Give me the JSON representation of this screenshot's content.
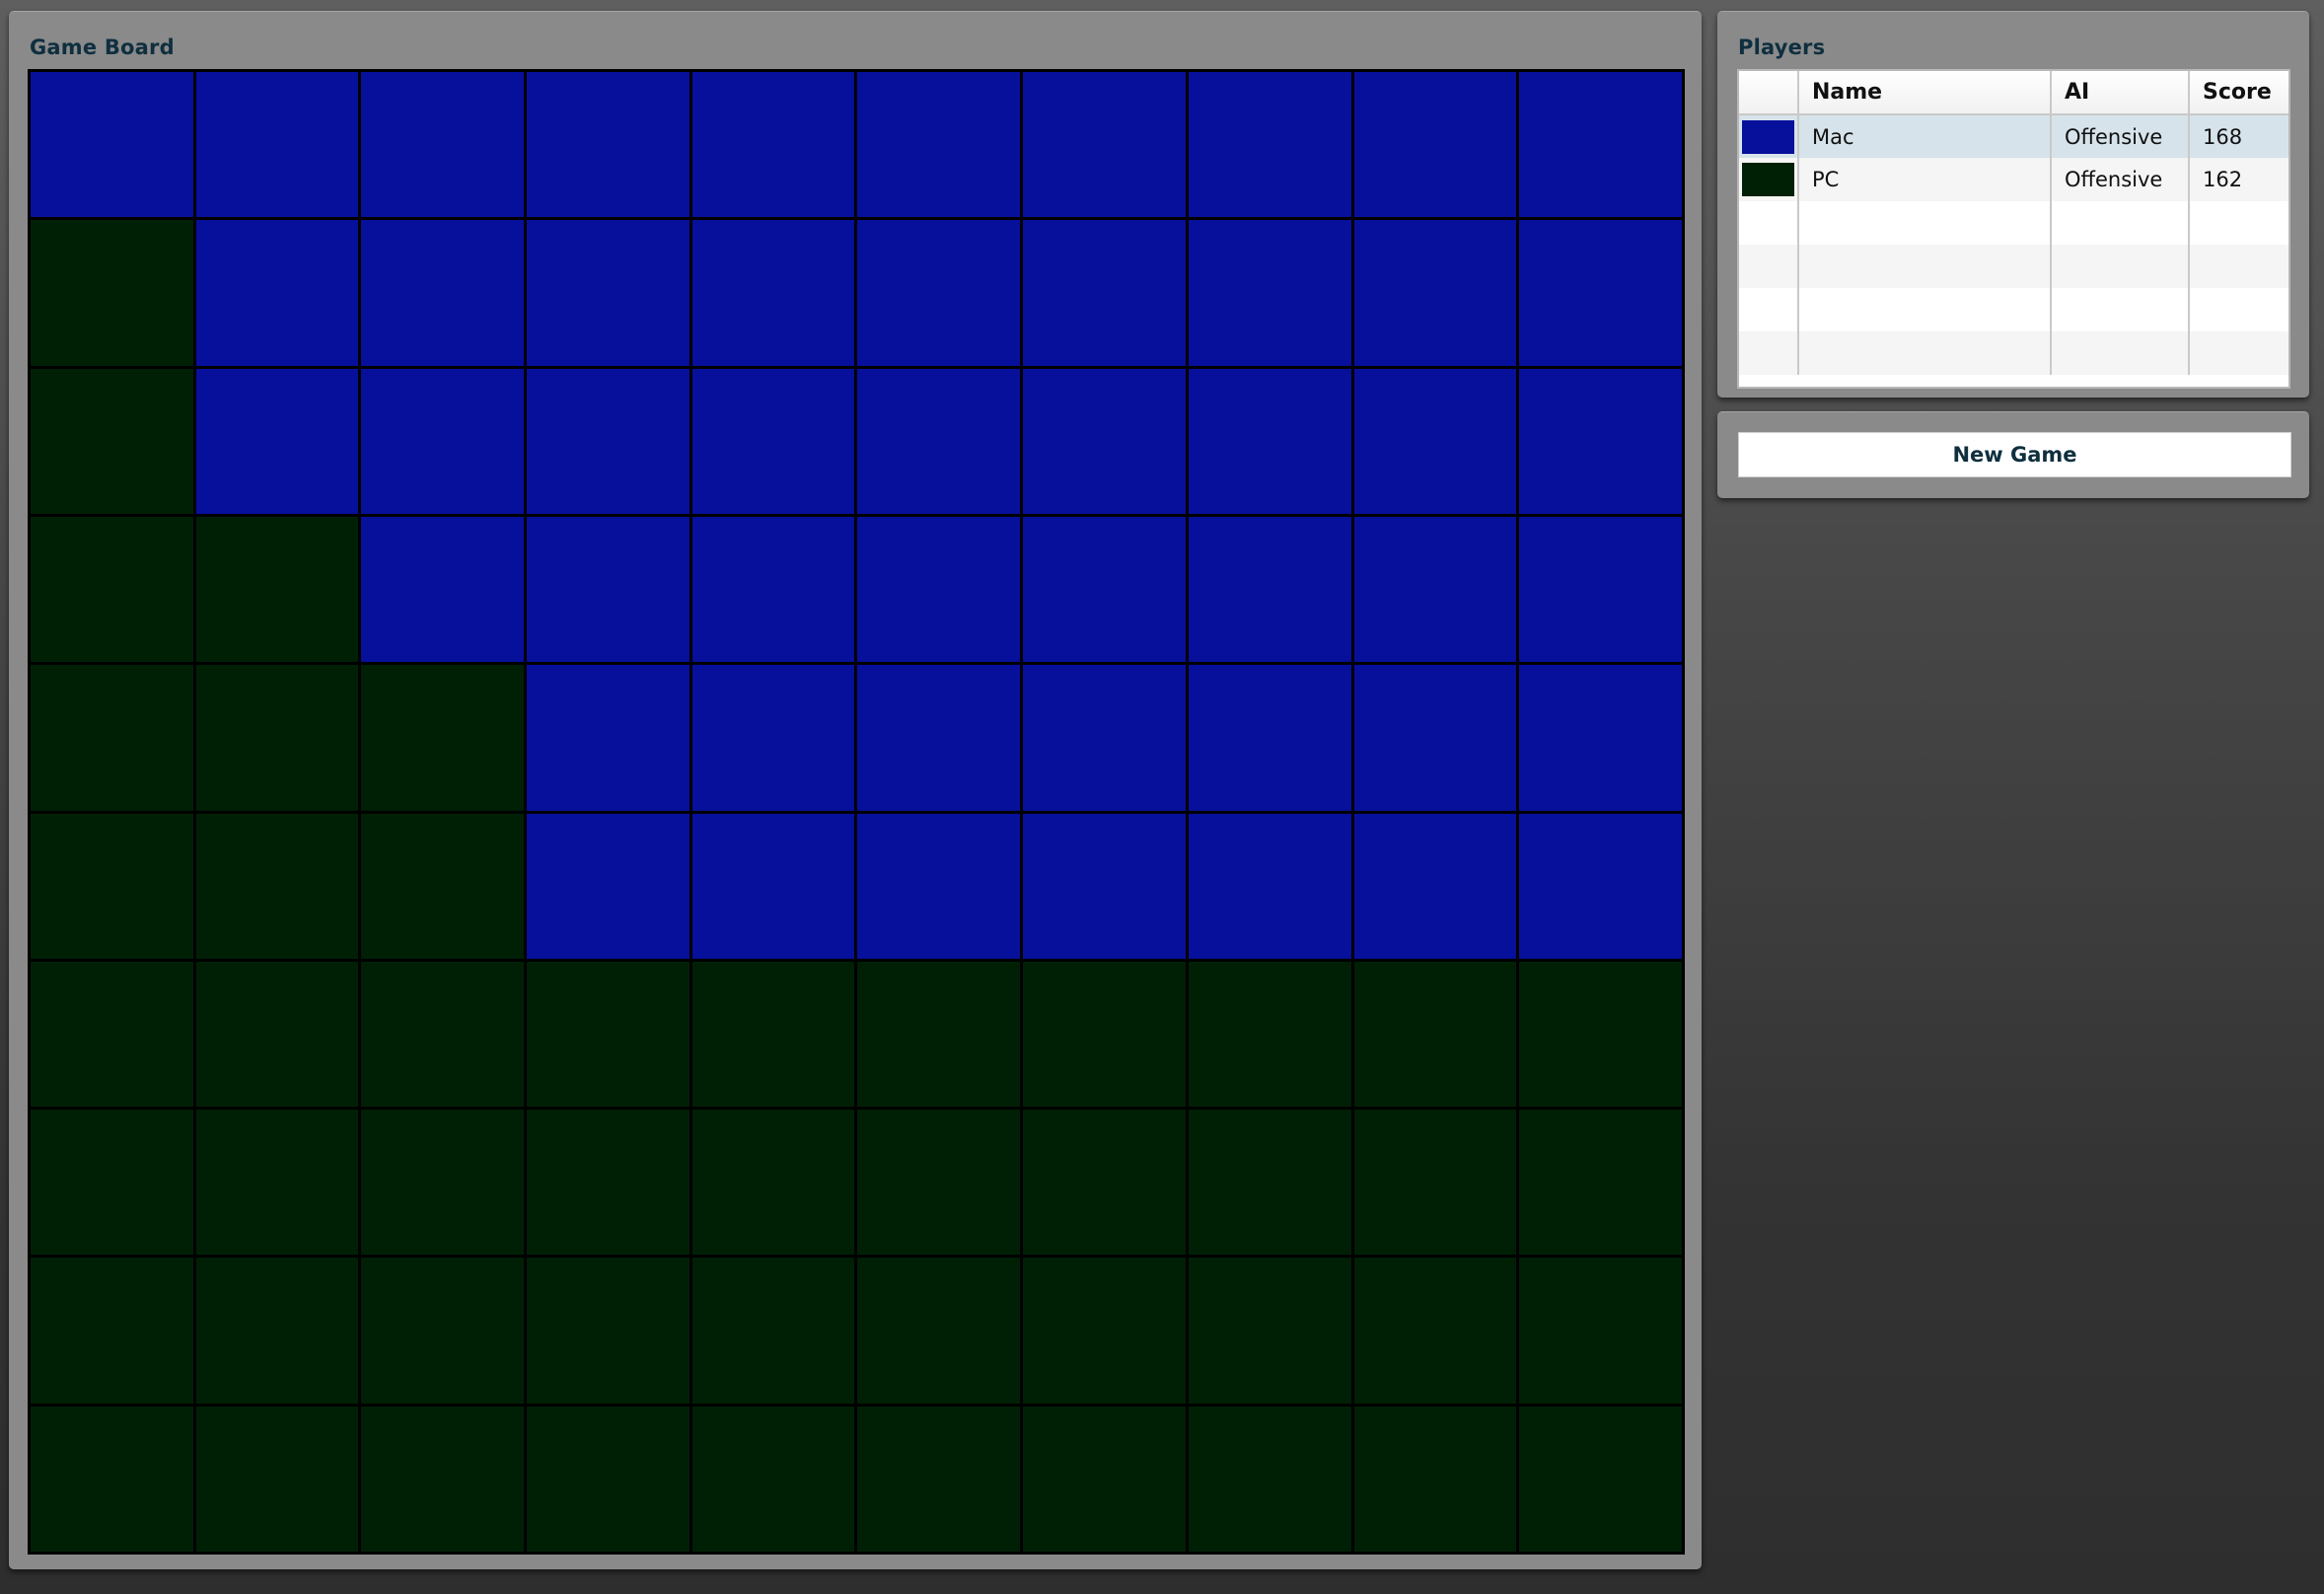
{
  "game_panel": {
    "title": "Game Board"
  },
  "board": {
    "rows": 10,
    "cols": 10,
    "colors": {
      "mac": "#06109a",
      "pc": "#002006"
    },
    "cells": [
      [
        "mac",
        "mac",
        "mac",
        "mac",
        "mac",
        "mac",
        "mac",
        "mac",
        "mac",
        "mac"
      ],
      [
        "pc",
        "mac",
        "mac",
        "mac",
        "mac",
        "mac",
        "mac",
        "mac",
        "mac",
        "mac"
      ],
      [
        "pc",
        "mac",
        "mac",
        "mac",
        "mac",
        "mac",
        "mac",
        "mac",
        "mac",
        "mac"
      ],
      [
        "pc",
        "pc",
        "mac",
        "mac",
        "mac",
        "mac",
        "mac",
        "mac",
        "mac",
        "mac"
      ],
      [
        "pc",
        "pc",
        "pc",
        "mac",
        "mac",
        "mac",
        "mac",
        "mac",
        "mac",
        "mac"
      ],
      [
        "pc",
        "pc",
        "pc",
        "mac",
        "mac",
        "mac",
        "mac",
        "mac",
        "mac",
        "mac"
      ],
      [
        "pc",
        "pc",
        "pc",
        "pc",
        "pc",
        "pc",
        "pc",
        "pc",
        "pc",
        "pc"
      ],
      [
        "pc",
        "pc",
        "pc",
        "pc",
        "pc",
        "pc",
        "pc",
        "pc",
        "pc",
        "pc"
      ],
      [
        "pc",
        "pc",
        "pc",
        "pc",
        "pc",
        "pc",
        "pc",
        "pc",
        "pc",
        "pc"
      ],
      [
        "pc",
        "pc",
        "pc",
        "pc",
        "pc",
        "pc",
        "pc",
        "pc",
        "pc",
        "pc"
      ]
    ]
  },
  "players_panel": {
    "title": "Players",
    "columns": {
      "color": "",
      "name": "Name",
      "ai": "AI",
      "score": "Score"
    },
    "rows": [
      {
        "color": "#06109a",
        "name": "Mac",
        "ai": "Offensive",
        "score": "168",
        "selected": true
      },
      {
        "color": "#002006",
        "name": "PC",
        "ai": "Offensive",
        "score": "162",
        "selected": false
      },
      {
        "color": "",
        "name": "",
        "ai": "",
        "score": ""
      },
      {
        "color": "",
        "name": "",
        "ai": "",
        "score": ""
      },
      {
        "color": "",
        "name": "",
        "ai": "",
        "score": ""
      },
      {
        "color": "",
        "name": "",
        "ai": "",
        "score": ""
      }
    ]
  },
  "controls": {
    "new_game_label": "New Game"
  }
}
